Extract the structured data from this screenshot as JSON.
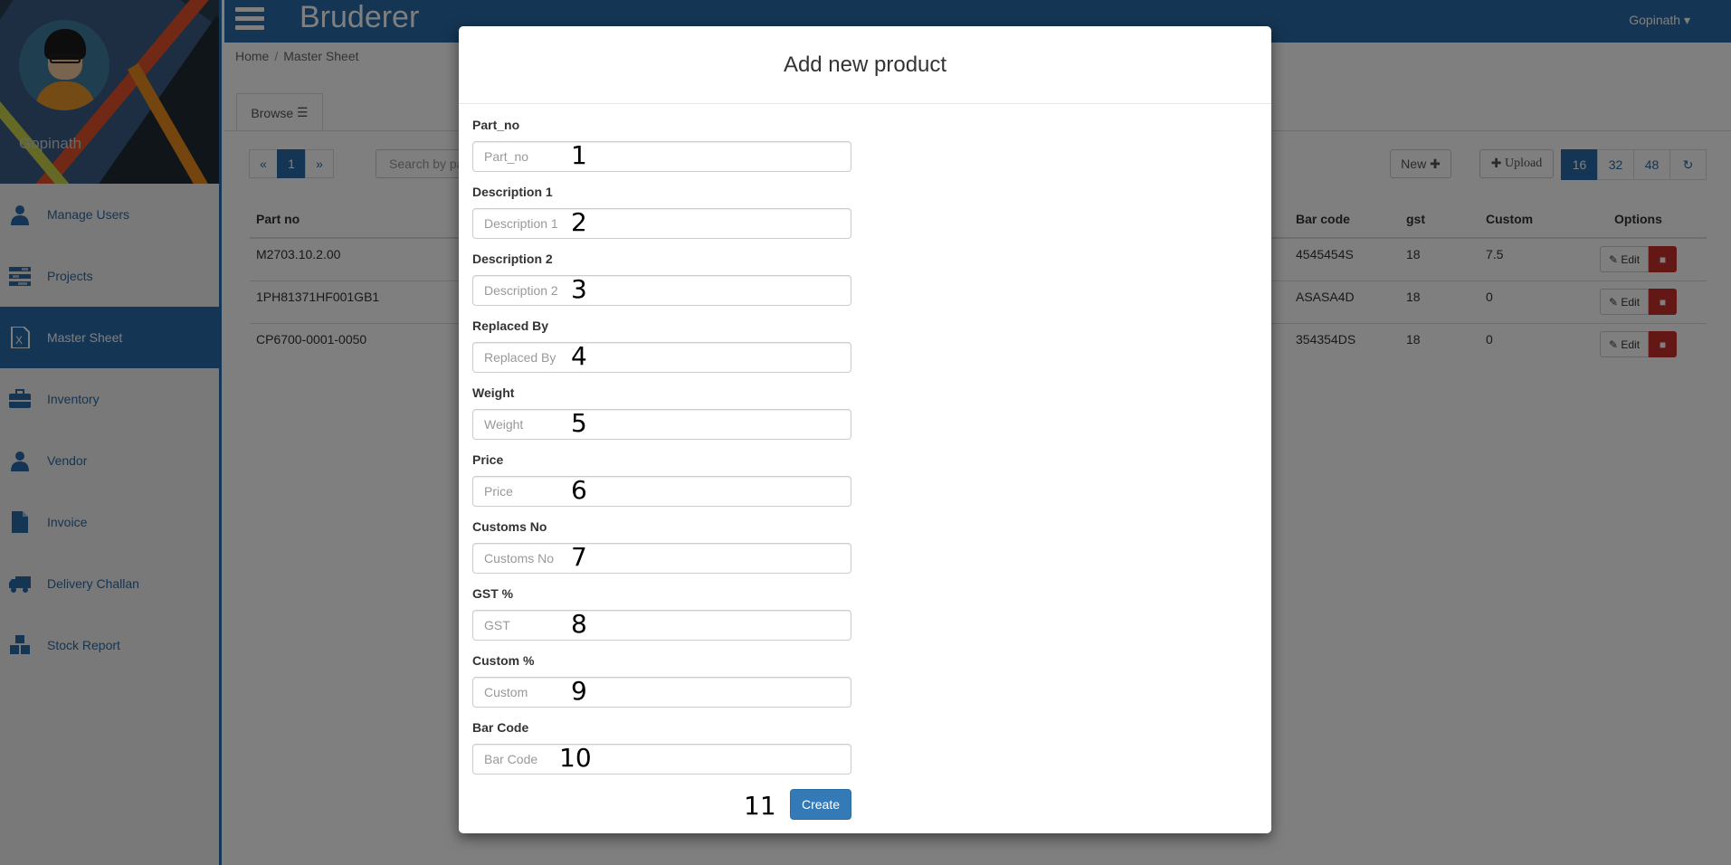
{
  "app": {
    "brand": "Bruderer",
    "user_menu": "Gopinath"
  },
  "sidebar": {
    "profile_name": "Gopinath",
    "items": [
      {
        "label": "Manage Users",
        "icon": "user-icon"
      },
      {
        "label": "Projects",
        "icon": "tasks-icon"
      },
      {
        "label": "Master Sheet",
        "icon": "excel-file-icon",
        "active": true
      },
      {
        "label": "Inventory",
        "icon": "briefcase-icon"
      },
      {
        "label": "Vendor",
        "icon": "user-icon"
      },
      {
        "label": "Invoice",
        "icon": "file-icon"
      },
      {
        "label": "Delivery Challan",
        "icon": "truck-icon"
      },
      {
        "label": "Stock Report",
        "icon": "cubes-icon"
      }
    ]
  },
  "breadcrumb": {
    "home": "Home",
    "current": "Master Sheet"
  },
  "browse_tab": "Browse",
  "pager": {
    "prev": "«",
    "current": "1",
    "next": "»"
  },
  "search": {
    "placeholder": "Search by part"
  },
  "toolbar": {
    "new_label": "New",
    "upload_label": "Upload",
    "page_sizes": [
      "16",
      "32",
      "48"
    ]
  },
  "table": {
    "columns": {
      "part_no": "Part no",
      "bar_code": "Bar code",
      "gst": "gst",
      "custom": "Custom",
      "options": "Options"
    },
    "rows": [
      {
        "part_no": "M2703.10.2.00",
        "bar_code": "4545454S",
        "gst": "18",
        "custom": "7.5"
      },
      {
        "part_no": "1PH81371HF001GB1",
        "bar_code": "ASASA4D",
        "gst": "18",
        "custom": "0"
      },
      {
        "part_no": "CP6700-0001-0050",
        "bar_code": "354354DS",
        "gst": "18",
        "custom": "0"
      }
    ],
    "edit_label": "Edit"
  },
  "modal": {
    "title": "Add new product",
    "fields": [
      {
        "label": "Part_no",
        "placeholder": "Part_no",
        "tag": "1"
      },
      {
        "label": "Description 1",
        "placeholder": "Description 1",
        "tag": "2"
      },
      {
        "label": "Description 2",
        "placeholder": "Description 2",
        "tag": "3"
      },
      {
        "label": "Replaced By",
        "placeholder": "Replaced By",
        "tag": "4"
      },
      {
        "label": "Weight",
        "placeholder": "Weight",
        "tag": "5"
      },
      {
        "label": "Price",
        "placeholder": "Price",
        "tag": "6"
      },
      {
        "label": "Customs No",
        "placeholder": "Customs No",
        "tag": "7"
      },
      {
        "label": "GST %",
        "placeholder": "GST",
        "tag": "8"
      },
      {
        "label": "Custom %",
        "placeholder": "Custom",
        "tag": "9"
      },
      {
        "label": "Bar Code",
        "placeholder": "Bar Code",
        "tag": "10"
      }
    ],
    "create_label": "Create",
    "create_tag": "11"
  },
  "colors": {
    "primary": "#2a6aa8",
    "danger": "#c9302c",
    "button_primary": "#337ab7"
  }
}
